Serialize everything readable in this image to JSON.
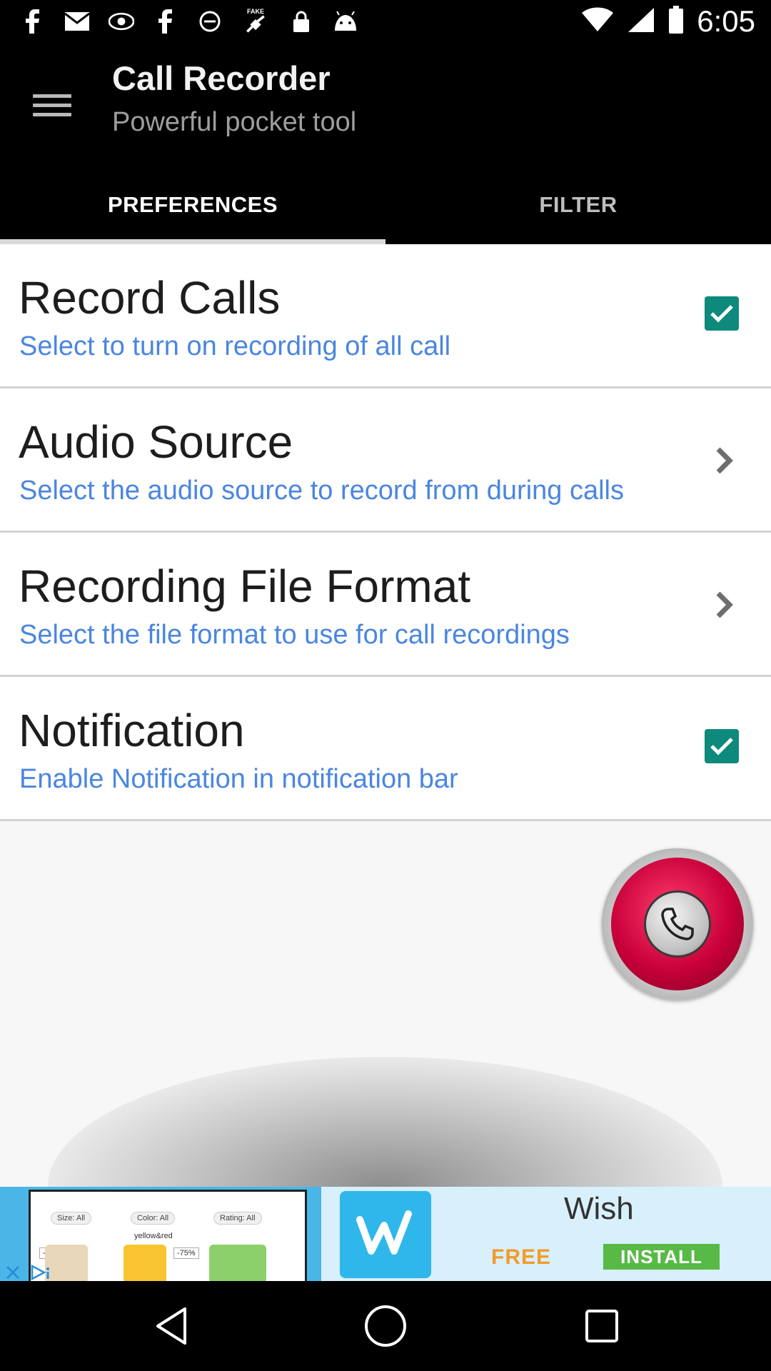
{
  "status_bar": {
    "time": "6:05",
    "icons": [
      "facebook-icon",
      "gmail-icon",
      "eye-icon",
      "facebook-icon",
      "blocked-icon",
      "fake-gps-icon",
      "lock-icon",
      "android-icon",
      "wifi-icon",
      "signal-icon",
      "battery-icon"
    ],
    "fake_gps_label": "FAKE"
  },
  "toolbar": {
    "title": "Call Recorder",
    "subtitle": "Powerful pocket tool"
  },
  "tabs": [
    {
      "label": "PREFERENCES",
      "selected": true
    },
    {
      "label": "FILTER",
      "selected": false
    }
  ],
  "preferences": [
    {
      "title": "Record Calls",
      "summary": "Select to turn on recording of all call",
      "widget": "checkbox",
      "checked": true
    },
    {
      "title": "Audio Source",
      "summary": "Select the audio source to record from during calls",
      "widget": "chevron"
    },
    {
      "title": "Recording File Format",
      "summary": "Select the file format to use for call recordings",
      "widget": "chevron"
    },
    {
      "title": "Notification",
      "summary": "Enable Notification in notification bar",
      "widget": "checkbox",
      "checked": true
    }
  ],
  "record_button": {
    "icon": "phone-icon"
  },
  "ad": {
    "app_name": "Wish",
    "free_label": "FREE",
    "install_label": "INSTALL",
    "filters": [
      "Size: All",
      "Color: All",
      "Rating: All"
    ],
    "product_text": "yellow&red",
    "discounts": [
      "-50%",
      "-75%"
    ]
  },
  "nav_bar": {
    "buttons": [
      "back-icon",
      "home-icon",
      "recents-icon"
    ]
  },
  "colors": {
    "accent_checkbox": "#0e8a7c",
    "summary_text": "#4a86e0",
    "record_red": "#c9003b",
    "install_green": "#59b947",
    "free_orange": "#f29b2a"
  }
}
